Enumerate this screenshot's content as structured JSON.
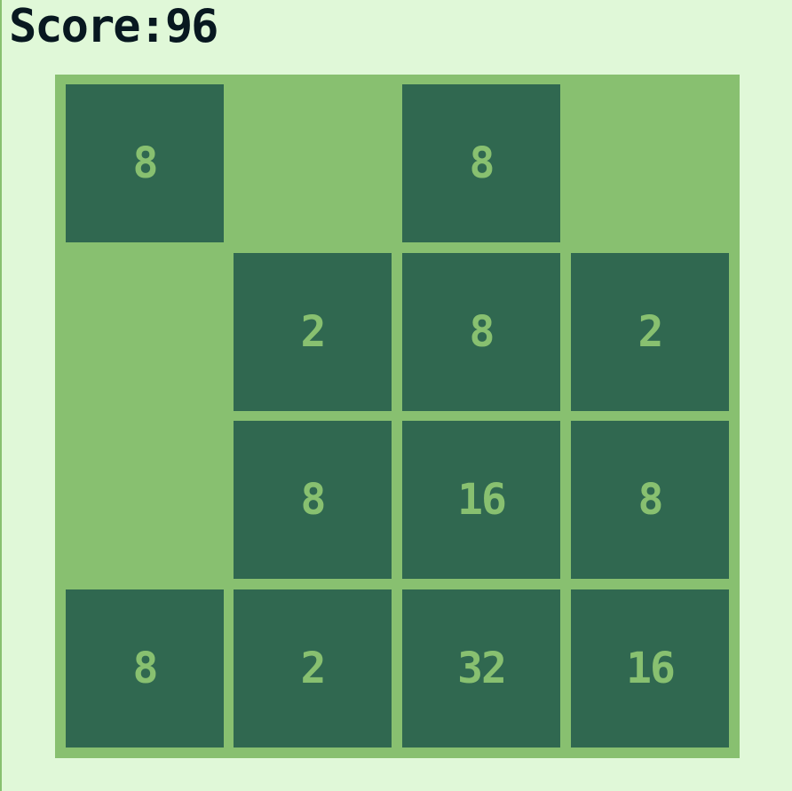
{
  "header": {
    "score_text": "Score:96"
  },
  "board": {
    "rows": [
      [
        "8",
        "",
        "8",
        ""
      ],
      [
        "",
        "2",
        "8",
        "2"
      ],
      [
        "",
        "8",
        "16",
        "8"
      ],
      [
        "8",
        "2",
        "32",
        "16"
      ]
    ]
  },
  "colors": {
    "background": "#e0f8d8",
    "board": "#88c070",
    "tile": "#306850",
    "tile_text": "#88c070",
    "score_text": "#081820"
  }
}
